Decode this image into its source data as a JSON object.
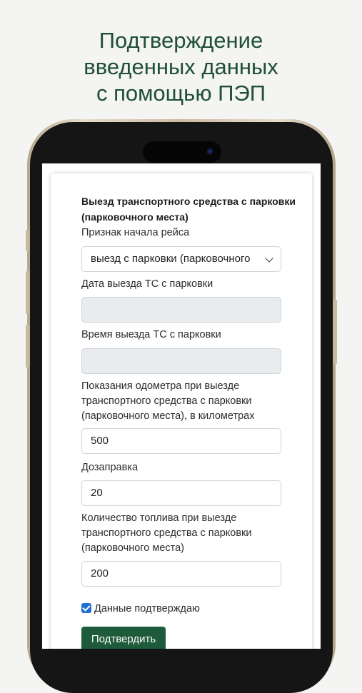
{
  "headline": {
    "line1": "Подтверждение",
    "line2": "введенных данных",
    "line3": "с помощью ПЭП"
  },
  "form": {
    "title": "Выезд транспортного средства с парковки (парковочного места)",
    "trip_start_label": "Признак начала рейса",
    "trip_start_value": "выезд с парковки (парковочного",
    "date_label": "Дата выезда ТС с парковки",
    "date_value": "",
    "time_label": "Время выезда ТС с парковки",
    "time_value": "",
    "odometer_label": "Показания одометра при выезде транспортного средства с парковки (парковочного места), в километрах",
    "odometer_value": "500",
    "refuel_label": "Дозаправка",
    "refuel_value": "20",
    "fuel_label": "Количество топлива при выезде транспортного средства с парковки (парковочного места)",
    "fuel_value": "200",
    "confirm_checkbox_label": "Данные подтверждаю",
    "confirm_checked": true,
    "submit_label": "Подтвердить"
  },
  "colors": {
    "headline": "#1f4f35",
    "button": "#1e5b3a",
    "checkbox": "#1f6ed4",
    "disabled_field": "#e9ecef"
  }
}
